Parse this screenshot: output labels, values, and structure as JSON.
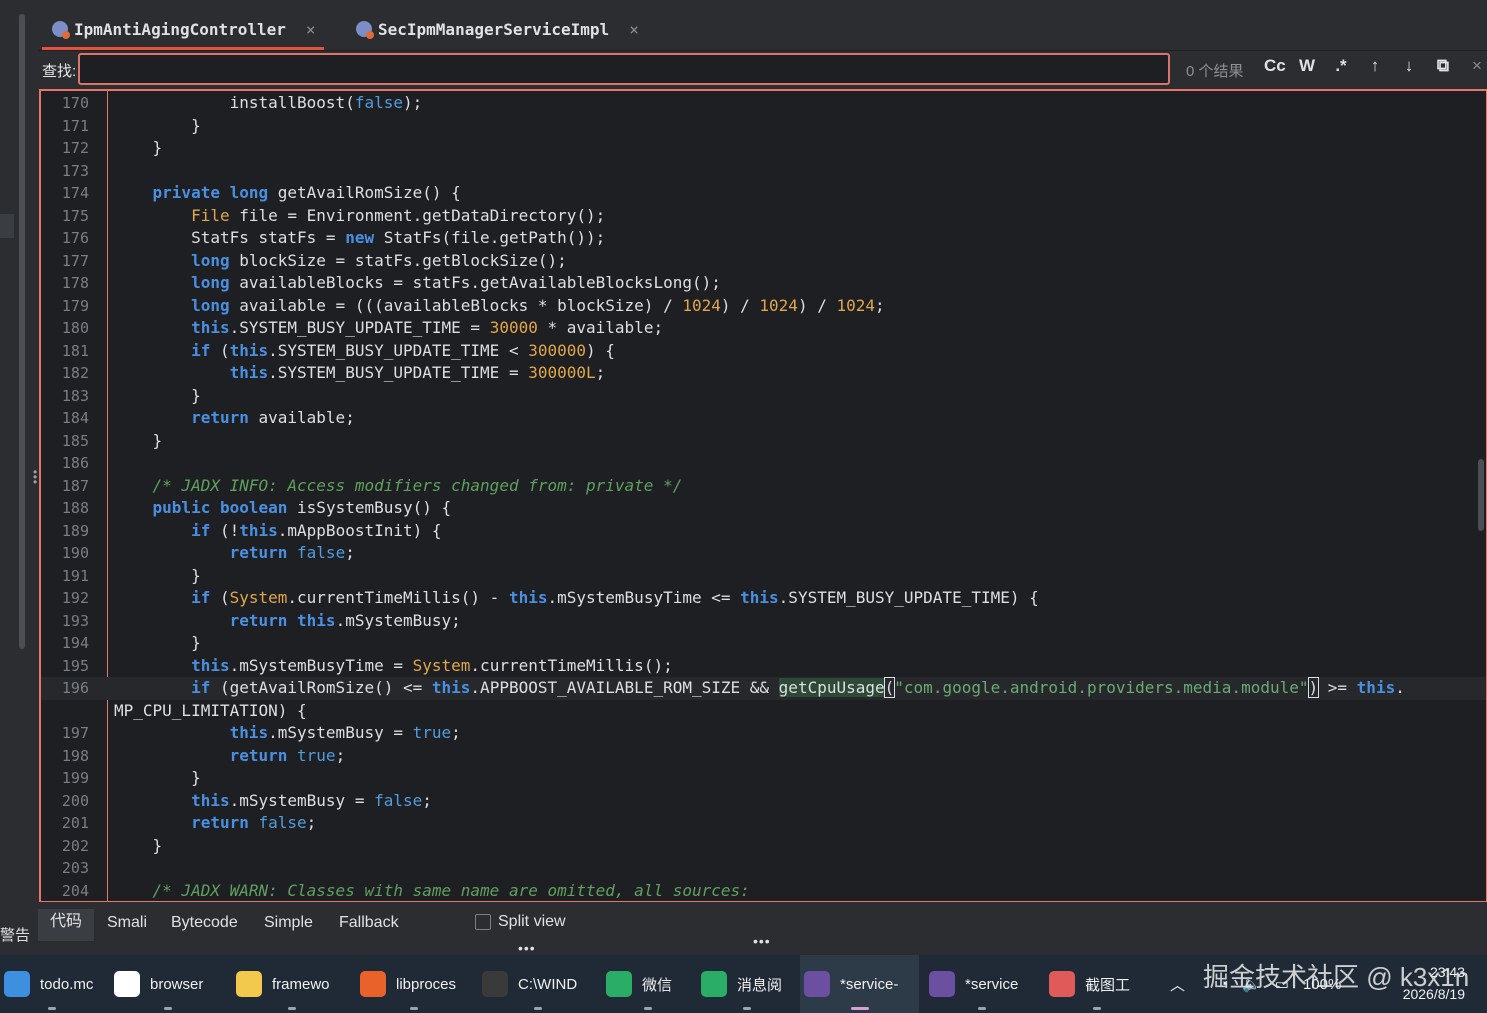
{
  "tabs": [
    {
      "label": "IpmAntiAgingController",
      "active": true
    },
    {
      "label": "SecIpmManagerServiceImpl",
      "active": false
    }
  ],
  "find": {
    "label": "查找:",
    "value": "",
    "result_count": "0 个结果",
    "tools": [
      "Cc",
      "W",
      ".*",
      "↑",
      "↓",
      "⧉",
      "×"
    ]
  },
  "code_lines": [
    {
      "n": "170",
      "html": "            installBoost(<span class='lit'>false</span>);"
    },
    {
      "n": "171",
      "html": "        }"
    },
    {
      "n": "172",
      "html": "    }"
    },
    {
      "n": "173",
      "html": ""
    },
    {
      "n": "174",
      "html": "    <span class='kw'>private</span> <span class='kw'>long</span> getAvailRomSize() {"
    },
    {
      "n": "175",
      "html": "        <span class='cls'>File</span> file = Environment.getDataDirectory();"
    },
    {
      "n": "176",
      "html": "        StatFs statFs = <span class='kw'>new</span> StatFs(file.getPath());"
    },
    {
      "n": "177",
      "html": "        <span class='kw'>long</span> blockSize = statFs.getBlockSize();"
    },
    {
      "n": "178",
      "html": "        <span class='kw'>long</span> availableBlocks = statFs.getAvailableBlocksLong();"
    },
    {
      "n": "179",
      "html": "        <span class='kw'>long</span> available = (((availableBlocks * blockSize) / <span class='num'>1024</span>) / <span class='num'>1024</span>) / <span class='num'>1024</span>;"
    },
    {
      "n": "180",
      "html": "        <span class='kw'>this</span>.SYSTEM_BUSY_UPDATE_TIME = <span class='num'>30000</span> * available;"
    },
    {
      "n": "181",
      "html": "        <span class='kw'>if</span> (<span class='kw'>this</span>.SYSTEM_BUSY_UPDATE_TIME &lt; <span class='num'>300000</span>) {"
    },
    {
      "n": "182",
      "html": "            <span class='kw'>this</span>.SYSTEM_BUSY_UPDATE_TIME = <span class='num'>300000L</span>;"
    },
    {
      "n": "183",
      "html": "        }"
    },
    {
      "n": "184",
      "html": "        <span class='kw'>return</span> available;"
    },
    {
      "n": "185",
      "html": "    }"
    },
    {
      "n": "186",
      "html": ""
    },
    {
      "n": "187",
      "html": "    <span class='com'>/* JADX INFO: Access modifiers changed from: private */</span>"
    },
    {
      "n": "188",
      "html": "    <span class='kw'>public</span> <span class='kw'>boolean</span> isSystemBusy() {"
    },
    {
      "n": "189",
      "html": "        <span class='kw'>if</span> (!<span class='kw'>this</span>.mAppBoostInit) {"
    },
    {
      "n": "190",
      "html": "            <span class='kw'>return</span> <span class='lit'>false</span>;"
    },
    {
      "n": "191",
      "html": "        }"
    },
    {
      "n": "192",
      "html": "        <span class='kw'>if</span> (<span class='cls'>System</span>.currentTimeMillis() - <span class='kw'>this</span>.mSystemBusyTime &lt;= <span class='kw'>this</span>.SYSTEM_BUSY_UPDATE_TIME) {"
    },
    {
      "n": "193",
      "html": "            <span class='kw'>return</span> <span class='kw'>this</span>.mSystemBusy;"
    },
    {
      "n": "194",
      "html": "        }"
    },
    {
      "n": "195",
      "html": "        <span class='kw'>this</span>.mSystemBusyTime = <span class='cls'>System</span>.currentTimeMillis();"
    },
    {
      "n": "196",
      "html": "        <span class='kw'>if</span> (getAvailRomSize() &lt;= <span class='kw'>this</span>.APPBOOST_AVAILABLE_ROM_SIZE &amp;&amp; <span class='hl'>getCpuUsage</span><span class='brk'>(</span><span class='str'>\"com.google.android.providers.media.module\"</span><span class='brk'>)</span> &gt;= <span class='kw'>this</span>.",
      "cur": true
    },
    {
      "n": "",
      "html": "MP_CPU_LIMITATION) {",
      "wrap": true
    },
    {
      "n": "197",
      "html": "            <span class='kw'>this</span>.mSystemBusy = <span class='lit'>true</span>;"
    },
    {
      "n": "198",
      "html": "            <span class='kw'>return</span> <span class='lit'>true</span>;"
    },
    {
      "n": "199",
      "html": "        }"
    },
    {
      "n": "200",
      "html": "        <span class='kw'>this</span>.mSystemBusy = <span class='lit'>false</span>;"
    },
    {
      "n": "201",
      "html": "        <span class='kw'>return</span> <span class='lit'>false</span>;"
    },
    {
      "n": "202",
      "html": "    }"
    },
    {
      "n": "203",
      "html": ""
    },
    {
      "n": "204",
      "html": "    <span class='com'>/* JADX WARN: Classes with same name are omitted, all sources:</span>"
    }
  ],
  "bottom": {
    "tabs": [
      "代码",
      "Smali",
      "Bytecode",
      "Simple",
      "Fallback"
    ],
    "split_view": "Split view",
    "warn_label": "警告"
  },
  "taskbar": {
    "items": [
      {
        "label": "todo.mc",
        "icon": "notepad-icon",
        "color": "#3d8fe0"
      },
      {
        "label": "browser",
        "icon": "browser-icon",
        "color": "#ffffff"
      },
      {
        "label": "framewo",
        "icon": "folder-icon",
        "color": "#f2c94c"
      },
      {
        "label": "libproces",
        "icon": "firefox-icon",
        "color": "#e8622a"
      },
      {
        "label": "C:\\WIND",
        "icon": "terminal-icon",
        "color": "#3a3a3a"
      },
      {
        "label": "微信",
        "icon": "wechat-icon",
        "color": "#2aae67"
      },
      {
        "label": "消息阅",
        "icon": "wechat-icon",
        "color": "#2aae67"
      },
      {
        "label": "*service-",
        "icon": "app-icon",
        "color": "#6b4fa0",
        "active": true
      },
      {
        "label": "*service",
        "icon": "app-icon",
        "color": "#6b4fa0"
      },
      {
        "label": "截图工",
        "icon": "snip-icon",
        "color": "#e05a5a"
      }
    ],
    "battery": "100%",
    "time": "23:43",
    "date": "2026/8/19",
    "watermark": "掘金技术社区 @ k3x1n"
  }
}
